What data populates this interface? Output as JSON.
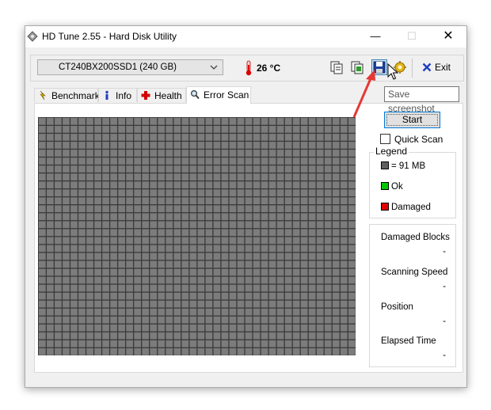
{
  "window": {
    "title": "HD Tune 2.55 - Hard Disk Utility",
    "controls": {
      "minimize": "—",
      "maximize": "☐",
      "close": "✕"
    }
  },
  "toolbar": {
    "drive": "CT240BX200SSD1 (240 GB)",
    "temperature": "26 °C",
    "exit_label": "Exit"
  },
  "tabs": [
    {
      "label": "Benchmark",
      "icon": "benchmark-icon",
      "active": false
    },
    {
      "label": "Info",
      "icon": "info-icon",
      "active": false
    },
    {
      "label": "Health",
      "icon": "health-icon",
      "active": false
    },
    {
      "label": "Error Scan",
      "icon": "magnifier-icon",
      "active": true
    }
  ],
  "error_scan": {
    "start_label": "Start",
    "quick_scan_label": "Quick Scan",
    "quick_scan_checked": false,
    "legend": {
      "title": "Legend",
      "items": [
        {
          "label": "= 91 MB",
          "color": "#5f5f5f"
        },
        {
          "label": "Ok",
          "color": "#00c800"
        },
        {
          "label": "Damaged",
          "color": "#e00000"
        }
      ]
    },
    "stats": [
      {
        "label": "Damaged Blocks",
        "value": "-"
      },
      {
        "label": "Scanning Speed",
        "value": "-"
      },
      {
        "label": "Position",
        "value": "-"
      },
      {
        "label": "Elapsed Time",
        "value": "-"
      }
    ],
    "grid": {
      "columns": 40,
      "rows": 30,
      "block_color": "#7c7c7c",
      "line_color": "#3a3a3a"
    }
  },
  "tooltip": "Save screenshot",
  "annotation_color": "#e53935"
}
